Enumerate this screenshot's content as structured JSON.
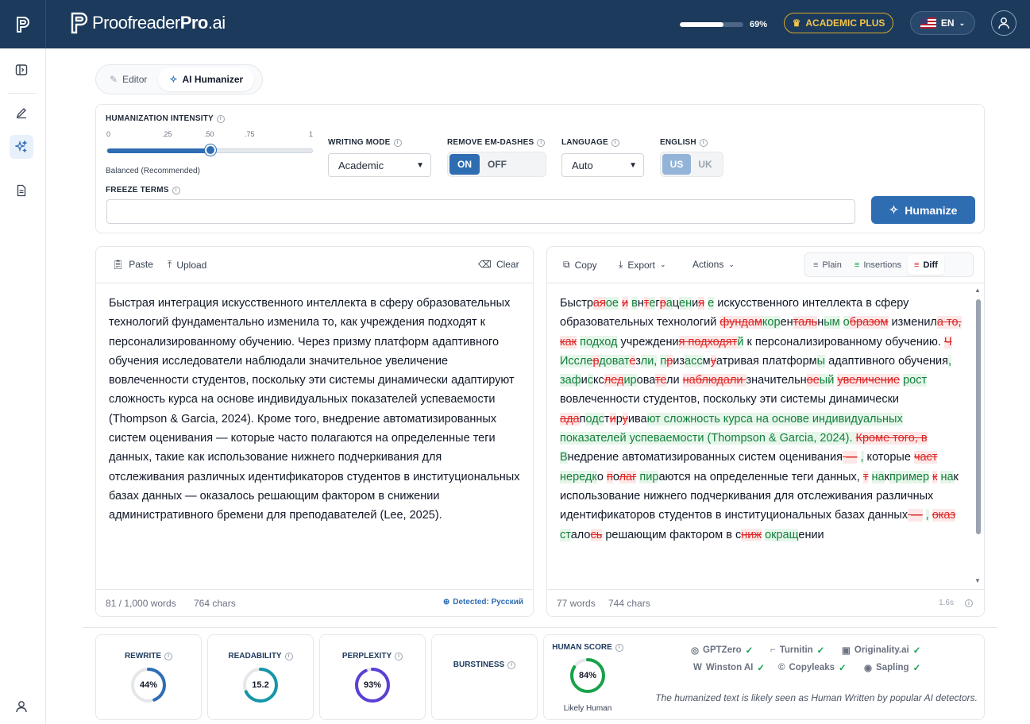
{
  "app": {
    "brand_plain": "Proofreader",
    "brand_bold": "Pro",
    "brand_suffix": ".ai"
  },
  "header": {
    "usage_percent": "69%",
    "usage_fraction": 0.69,
    "plan_badge": "ACADEMIC PLUS",
    "language": "EN",
    "flag": "us-flag"
  },
  "colors": {
    "header_bg": "#1b3a5c",
    "accent": "#2f6db3",
    "deleted": "#dc2626",
    "inserted": "#15803d",
    "plan_gold": "#f5c44a"
  },
  "sidebar": {
    "icons": [
      "collapse-panel-icon",
      "pen-icon",
      "sparkle-icon",
      "document-icon",
      "user-icon"
    ],
    "active": "sparkle-icon"
  },
  "tabs": {
    "editor": "Editor",
    "humanizer": "AI Humanizer",
    "active": "AI Humanizer"
  },
  "settings": {
    "intensity_label": "HUMANIZATION INTENSITY",
    "ticks": [
      "0",
      ".25",
      ".50",
      ".75",
      "1"
    ],
    "intensity_value": 0.5,
    "intensity_caption": "Balanced (Recommended)",
    "writing_mode_label": "WRITING MODE",
    "writing_mode": "Academic",
    "em_dash_label": "REMOVE EM-DASHES",
    "on": "ON",
    "off": "OFF",
    "language_label": "LANGUAGE",
    "language": "Auto",
    "english_label": "ENGLISH",
    "us": "US",
    "uk": "UK",
    "freeze_label": "FREEZE TERMS",
    "freeze_value": "",
    "humanize": "Humanize"
  },
  "input": {
    "paste": "Paste",
    "upload": "Upload",
    "clear": "Clear",
    "text": "Быстрая интеграция искусственного интеллекта в сферу образовательных технологий фундаментально изменила то, как учреждения подходят к персонализированному обучению. Через призму платформ адаптивного обучения исследователи наблюдали значительное увеличение вовлеченности студентов, поскольку эти системы динамически адаптируют сложность курса на основе индивидуальных показателей успеваемости (Thompson & Garcia, 2024). Кроме того, внедрение автоматизированных систем оценивания — которые часто полагаются на определенные теги данных, такие как использование нижнего подчеркивания для отслеживания различных идентификаторов студентов в институциональных базах данных — оказалось решающим фактором в снижении административного бремени для преподавателей (Lee, 2025).",
    "word_count": "81 / 1,000 words",
    "char_count": "764 chars",
    "detected": "Detected: Русский"
  },
  "output": {
    "copy": "Copy",
    "export": "Export",
    "actions": "Actions",
    "views": [
      "Plain",
      "Insertions",
      "Diff"
    ],
    "active_view": "Diff",
    "word_count": "77 words",
    "char_count": "744 chars",
    "time": "1.6s",
    "diff": [
      [
        "e",
        "Быстр"
      ],
      [
        "d",
        "ая"
      ],
      [
        "i",
        "ое"
      ],
      [
        "e",
        " "
      ],
      [
        "d",
        "и"
      ],
      [
        "e",
        " "
      ],
      [
        "i",
        "в"
      ],
      [
        "e",
        "н"
      ],
      [
        "d",
        "т"
      ],
      [
        "i",
        "е"
      ],
      [
        "e",
        "г"
      ],
      [
        "d",
        "р"
      ],
      [
        "i",
        "а"
      ],
      [
        "e",
        "ц"
      ],
      [
        "i",
        "ен"
      ],
      [
        "e",
        "и"
      ],
      [
        "d",
        "я"
      ],
      [
        "e",
        " "
      ],
      [
        "i",
        "е"
      ],
      [
        "e",
        " искусственного интеллекта в сферу образовательных технологий "
      ],
      [
        "d",
        "фундам"
      ],
      [
        "i",
        "кор"
      ],
      [
        "e",
        "ен"
      ],
      [
        "d",
        "таль"
      ],
      [
        "e",
        "н"
      ],
      [
        "i",
        "ым"
      ],
      [
        "e",
        " "
      ],
      [
        "i",
        "о"
      ],
      [
        "d",
        "бразом"
      ],
      [
        "e",
        " изменил"
      ],
      [
        "d",
        "а то"
      ],
      [
        "d",
        ", как"
      ],
      [
        "e",
        " "
      ],
      [
        "i",
        "подход"
      ],
      [
        "e",
        " учреждени"
      ],
      [
        "d",
        "я подходят"
      ],
      [
        "i",
        "й"
      ],
      [
        "e",
        " к персонализированному обучению. "
      ],
      [
        "d",
        "Ч"
      ],
      [
        "e",
        " "
      ],
      [
        "i",
        "Иссле"
      ],
      [
        "d",
        "р"
      ],
      [
        "i",
        "доват"
      ],
      [
        "d",
        "е"
      ],
      [
        "e",
        "з"
      ],
      [
        "i",
        "ли,"
      ],
      [
        "e",
        " "
      ],
      [
        "i",
        "п"
      ],
      [
        "d",
        "р"
      ],
      [
        "e",
        "из"
      ],
      [
        "i",
        "асс"
      ],
      [
        "e",
        "м"
      ],
      [
        "d",
        "у"
      ],
      [
        "e",
        "атривая платформ"
      ],
      [
        "i",
        "ы"
      ],
      [
        "e",
        " адаптивного обучения"
      ],
      [
        "i",
        ","
      ],
      [
        "e",
        " "
      ],
      [
        "i",
        "заф"
      ],
      [
        "e",
        "и"
      ],
      [
        "i",
        "с"
      ],
      [
        "e",
        "кс"
      ],
      [
        "d",
        "лед"
      ],
      [
        "i",
        "ир"
      ],
      [
        "e",
        "ова"
      ],
      [
        "d",
        "те"
      ],
      [
        "e",
        "ли "
      ],
      [
        "d",
        "наблюдали "
      ],
      [
        "e",
        "значительн"
      ],
      [
        "d",
        "ое"
      ],
      [
        "i",
        "ый"
      ],
      [
        "e",
        " "
      ],
      [
        "d",
        "увеличение"
      ],
      [
        "e",
        " "
      ],
      [
        "i",
        "рост"
      ],
      [
        "e",
        " вовлеченности студентов, поскольку эти системы динамически "
      ],
      [
        "d",
        "ада"
      ],
      [
        "e",
        "п"
      ],
      [
        "i",
        "одс"
      ],
      [
        "e",
        "т"
      ],
      [
        "d",
        "и"
      ],
      [
        "e",
        "р"
      ],
      [
        "d",
        "у"
      ],
      [
        "e",
        "ива"
      ],
      [
        "i",
        "ют сложность курса на основе индивидуальных показателей успеваемости (Thompson & Garcia, 2024). "
      ],
      [
        "d",
        "Кроме того, в"
      ],
      [
        "e",
        " "
      ],
      [
        "i",
        "В"
      ],
      [
        "e",
        "недрение автоматизированных систем оценивания"
      ],
      [
        "d",
        " —"
      ],
      [
        "e",
        " "
      ],
      [
        "i",
        ","
      ],
      [
        "e",
        " которые "
      ],
      [
        "d",
        "част"
      ],
      [
        "e",
        " "
      ],
      [
        "i",
        "нередк"
      ],
      [
        "e",
        "о "
      ],
      [
        "d",
        "п"
      ],
      [
        "e",
        "о"
      ],
      [
        "d",
        "лаг"
      ],
      [
        "e",
        " "
      ],
      [
        "i",
        "пир"
      ],
      [
        "e",
        "аются на определенные теги данных, "
      ],
      [
        "d",
        "т"
      ],
      [
        "e",
        " "
      ],
      [
        "i",
        "на"
      ],
      [
        "e",
        "к"
      ],
      [
        "i",
        "пример"
      ],
      [
        "e",
        " "
      ],
      [
        "d",
        "к"
      ],
      [
        "e",
        " "
      ],
      [
        "i",
        "на"
      ],
      [
        "e",
        "к"
      ],
      [
        "d",
        " "
      ],
      [
        "e",
        "использование нижнего подчеркивания для отслеживания различных идентификаторов студентов в институциональных базах данных"
      ],
      [
        "d",
        " —"
      ],
      [
        "e",
        " "
      ],
      [
        "i",
        ","
      ],
      [
        "e",
        " "
      ],
      [
        "d",
        "оказ"
      ],
      [
        "e",
        " "
      ],
      [
        "i",
        "ст"
      ],
      [
        "e",
        "ало"
      ],
      [
        "d",
        "сь"
      ],
      [
        "e",
        " решающим фактором в с"
      ],
      [
        "d",
        "ниж"
      ],
      [
        "e",
        " "
      ],
      [
        "i",
        "окращ"
      ],
      [
        "e",
        "ении"
      ]
    ]
  },
  "metrics": {
    "rewrite": {
      "label": "REWRITE",
      "value": "44%",
      "fraction": 0.44,
      "color": "#2f6db3"
    },
    "readability": {
      "label": "READABILITY",
      "value": "15.2",
      "fraction": 0.68,
      "color": "#1596a8"
    },
    "perplexity": {
      "label": "PERPLEXITY",
      "value": "93%",
      "fraction": 0.93,
      "color": "#5b3fd6"
    },
    "burstiness": {
      "label": "BURSTINESS"
    },
    "human": {
      "label": "HUMAN SCORE",
      "value": "84%",
      "fraction": 0.84,
      "color": "#16a34a",
      "caption": "Likely Human"
    }
  },
  "detectors": [
    {
      "name": "GPTZero",
      "icon": "gptzero-icon"
    },
    {
      "name": "Turnitin",
      "icon": "turnitin-icon"
    },
    {
      "name": "Originality.ai",
      "icon": "originality-icon"
    },
    {
      "name": "Winston AI",
      "icon": "winston-icon"
    },
    {
      "name": "Copyleaks",
      "icon": "copyleaks-icon"
    },
    {
      "name": "Sapling",
      "icon": "sapling-icon"
    }
  ],
  "detector_note": "The humanized text is likely seen as Human Written by popular AI detectors."
}
